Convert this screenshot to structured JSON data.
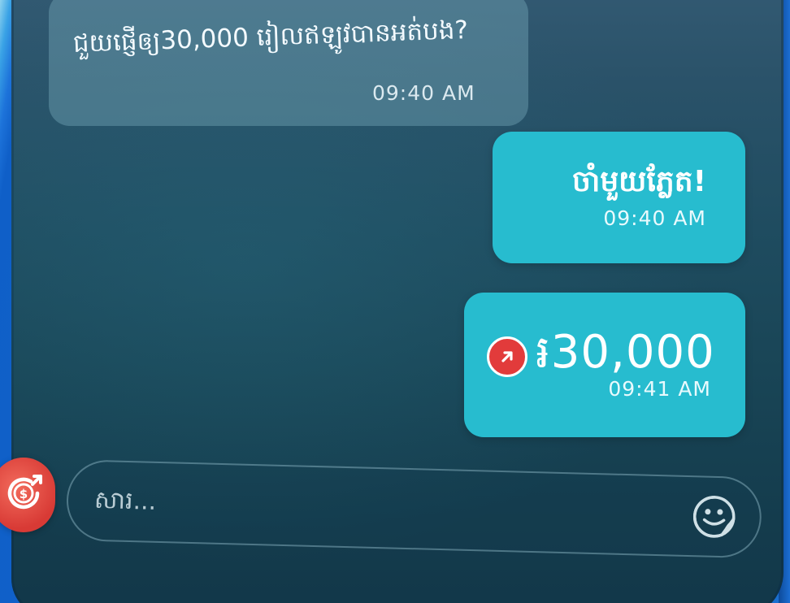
{
  "chat": {
    "messages": [
      {
        "direction": "incoming",
        "text": "ជួយផ្ញើឲ្យ30,000 រៀលឥឡូវបានអត់បង?",
        "time": "09:40 AM"
      },
      {
        "direction": "outgoing",
        "text": "ចាំមួយភ្លែត!",
        "time": "09:40 AM"
      },
      {
        "direction": "outgoing",
        "type": "money-transfer",
        "amount": "៛30,000",
        "time": "09:41 AM",
        "icon": "arrow-up-right-icon"
      }
    ]
  },
  "composer": {
    "placeholder": "សារ...",
    "left_button_icon": "money-transfer-icon",
    "right_button_icon": "emoji-icon"
  },
  "colors": {
    "outgoing_bubble": "#27bccf",
    "incoming_bubble": "#6fa2b2",
    "money_button": "#e23b3b",
    "chat_background": "#1f4c60"
  }
}
